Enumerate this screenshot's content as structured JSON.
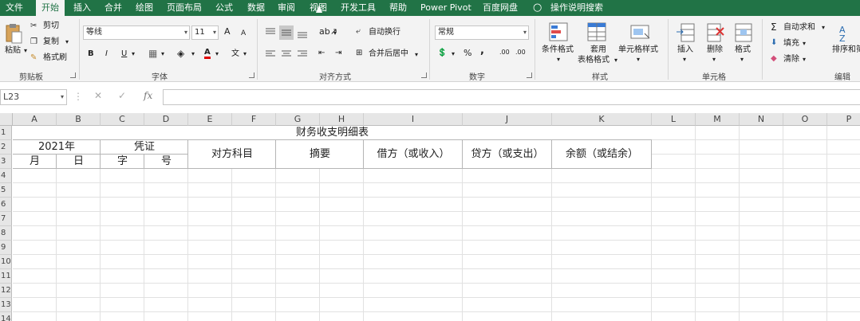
{
  "tabs": [
    "文件",
    "开始",
    "插入",
    "合并",
    "绘图",
    "页面布局",
    "公式",
    "数据",
    "审阅",
    "视图",
    "开发工具",
    "帮助",
    "Power Pivot",
    "百度网盘",
    "操作说明搜索"
  ],
  "clipboard": {
    "paste": "粘贴",
    "cut": "剪切",
    "copy": "复制",
    "painter": "格式刷",
    "label": "剪贴板"
  },
  "font": {
    "name": "等线",
    "size": "11",
    "bold": "B",
    "italic": "I",
    "underline": "U",
    "grow": "A",
    "shrink": "A",
    "font_color": "A",
    "wen": "文",
    "label": "字体"
  },
  "align": {
    "wrap": "自动换行",
    "merge": "合并后居中",
    "label": "对齐方式"
  },
  "number": {
    "format": "常规",
    "percent": "%",
    "comma": ",",
    "inc": ".00",
    "dec": ".00",
    "label": "数字"
  },
  "styles": {
    "cond": "条件格式",
    "table_1": "套用",
    "table_2": "表格格式",
    "cell": "单元格样式",
    "label": "样式"
  },
  "cells": {
    "insert": "插入",
    "delete": "删除",
    "format": "格式",
    "label": "单元格"
  },
  "editing": {
    "autosum": "自动求和",
    "fill": "填充",
    "clear": "清除",
    "sort": "排序和筛",
    "label": "编辑"
  },
  "formula_bar": {
    "name_box": "L23",
    "fx": "fx",
    "cancel": "✕",
    "confirm": "✓"
  },
  "columns": [
    "A",
    "B",
    "C",
    "D",
    "E",
    "F",
    "G",
    "H",
    "I",
    "J",
    "K",
    "L",
    "M",
    "N",
    "O",
    "P"
  ],
  "rows": [
    "1",
    "2",
    "3",
    "4",
    "5",
    "6",
    "7",
    "8",
    "9",
    "10",
    "11",
    "12",
    "13",
    "14"
  ],
  "sheet": {
    "title": "财务收支明细表",
    "year": "2021年",
    "voucher": "凭证",
    "month": "月",
    "day": "日",
    "zi": "字",
    "hao": "号",
    "account": "对方科目",
    "summary": "摘要",
    "debit": "借方（或收入）",
    "credit": "贷方（或支出）",
    "balance": "余额（或结余）"
  }
}
